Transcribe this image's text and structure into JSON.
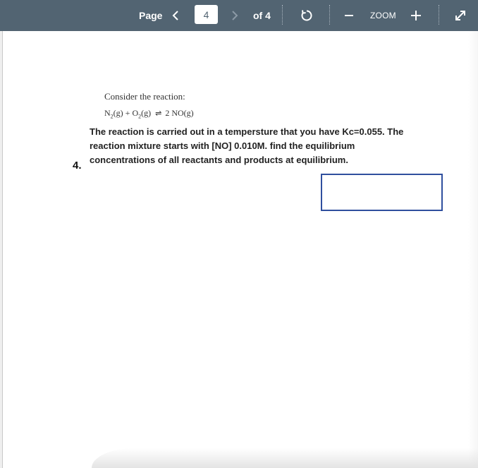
{
  "toolbar": {
    "page_label": "Page",
    "current_page": "4",
    "of_label": "of 4",
    "zoom_label": "ZOOM",
    "icons": {
      "prev": "chevron-left-icon",
      "next": "chevron-right-icon",
      "rotate": "rotate-icon",
      "zoom_out": "minus-icon",
      "zoom_in": "plus-icon",
      "fullscreen": "expand-icon"
    },
    "colors": {
      "background": "#526472",
      "text": "#ffffff"
    }
  },
  "document": {
    "consider_text": "Consider the reaction:",
    "equation": {
      "reactant1": "N",
      "reactant1_sub": "2",
      "reactant1_state": "(g)",
      "plus": "+",
      "reactant2": "O",
      "reactant2_sub": "2",
      "reactant2_state": "(g)",
      "arrow": "⇌",
      "product": "2 NO(g)"
    },
    "question_number": "4.",
    "question_text": "The reaction is carried out in a tempersture that you have Kc=0.055. The reaction mixture starts with [NO] 0.010M. find the equilibrium concentrations of all reactants and products at equilibrium.",
    "answer_box_color": "#2f4f9e"
  }
}
